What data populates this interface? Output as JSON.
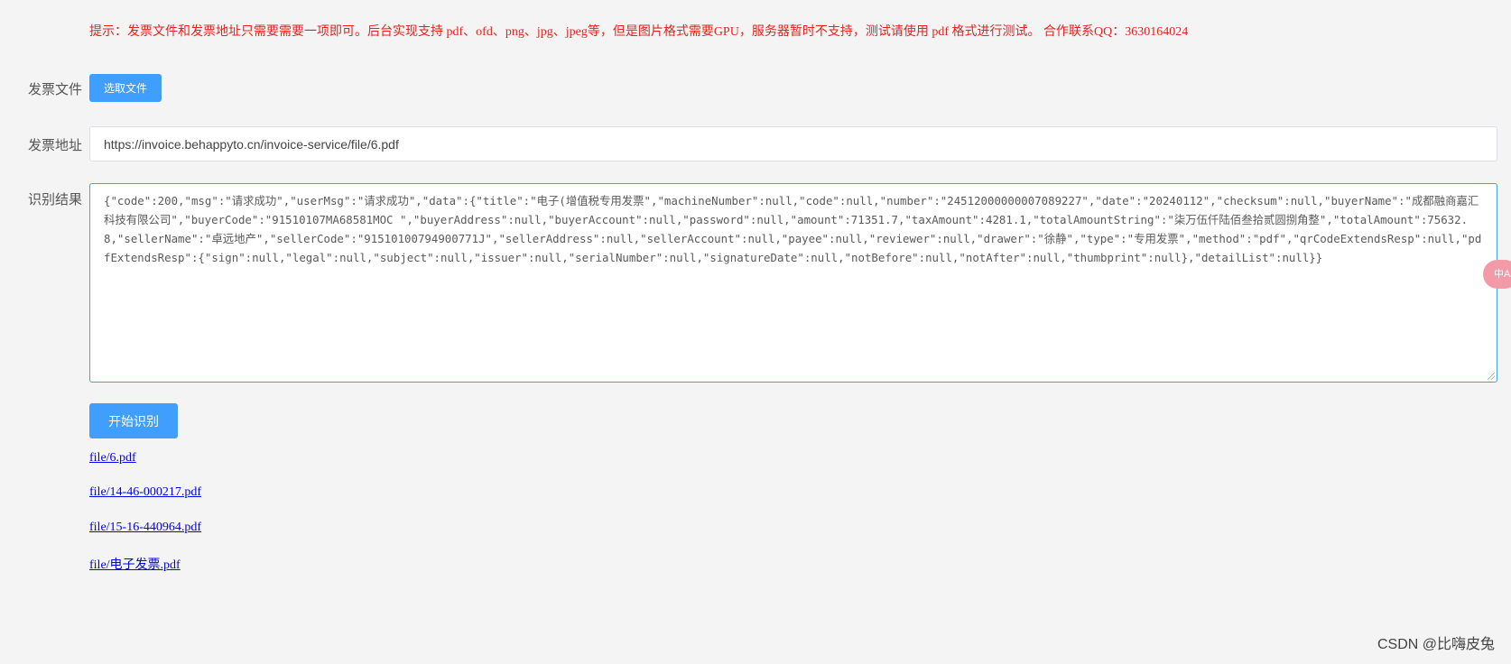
{
  "notice": "提示：发票文件和发票地址只需要需要一项即可。后台实现支持 pdf、ofd、png、jpg、jpeg等，但是图片格式需要GPU，服务器暂时不支持，测试请使用 pdf 格式进行测试。 合作联系QQ：3630164024",
  "form": {
    "file_label": "发票文件",
    "file_button": "选取文件",
    "url_label": "发票地址",
    "url_value": "https://invoice.behappyto.cn/invoice-service/file/6.pdf",
    "result_label": "识别结果",
    "result_value": "{\"code\":200,\"msg\":\"请求成功\",\"userMsg\":\"请求成功\",\"data\":{\"title\":\"电子(增值税专用发票\",\"machineNumber\":null,\"code\":null,\"number\":\"24512000000007089227\",\"date\":\"20240112\",\"checksum\":null,\"buyerName\":\"成都融商嘉汇科技有限公司\",\"buyerCode\":\"91510107MA68581MOC \",\"buyerAddress\":null,\"buyerAccount\":null,\"password\":null,\"amount\":71351.7,\"taxAmount\":4281.1,\"totalAmountString\":\"柒万伍仟陆佰叁拾贰圆捌角整\",\"totalAmount\":75632.8,\"sellerName\":\"卓远地产\",\"sellerCode\":\"91510100794900771J\",\"sellerAddress\":null,\"sellerAccount\":null,\"payee\":null,\"reviewer\":null,\"drawer\":\"徐静\",\"type\":\"专用发票\",\"method\":\"pdf\",\"qrCodeExtendsResp\":null,\"pdfExtendsResp\":{\"sign\":null,\"legal\":null,\"subject\":null,\"issuer\":null,\"serialNumber\":null,\"signatureDate\":null,\"notBefore\":null,\"notAfter\":null,\"thumbprint\":null},\"detailList\":null}}",
    "start_button": "开始识别"
  },
  "file_links": [
    "file/6.pdf",
    "file/14-46-000217.pdf",
    "file/15-16-440964.pdf",
    "file/电子发票.pdf"
  ],
  "watermark": "CSDN @比嗨皮兔",
  "translate_widget": "中A",
  "colors": {
    "notice_text": "#e8211c",
    "primary_button": "#409eff",
    "link": "#0000ee",
    "page_background": "#f4f4f4"
  }
}
